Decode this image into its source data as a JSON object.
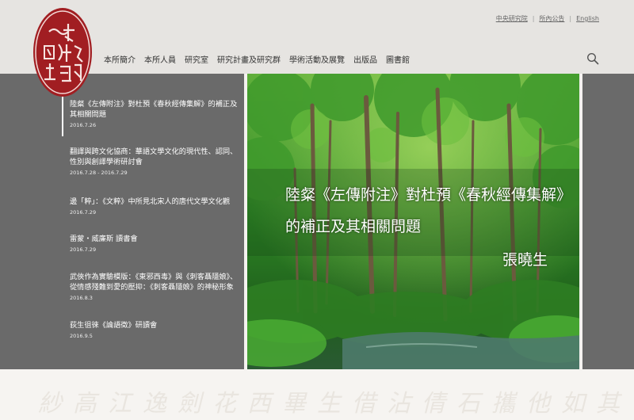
{
  "header": {
    "top_links": [
      "中央研究院",
      "所內公告",
      "English"
    ],
    "seal_text": "中國文哲研究所",
    "nav": [
      "本所簡介",
      "本所人員",
      "研究室",
      "研究計畫及研究群",
      "學術活動及展覽",
      "出版品",
      "圖書館"
    ]
  },
  "news": [
    {
      "title": "陸粲《左傳附注》對杜預《春秋經傳集解》的補正及其相關問題",
      "date": "2016.7.26"
    },
    {
      "title": "翻譯與跨文化協商：華語文學文化的現代性、認同、性別與創譯學術研討會",
      "date": "2016.7.28 - 2016.7.29"
    },
    {
      "title": "邊「粹」：《文粹》中所見北宋人的唐代文學文化觀",
      "date": "2016.7.29"
    },
    {
      "title": "雷蒙・威廉斯 讀書會",
      "date": "2016.7.29"
    },
    {
      "title": "武俠作為實驗模版：《東邪西毒》與《刺客聶隱娘》、從情感殘難到愛的壓抑：《刺客聶隱娘》的神秘形象",
      "date": "2016.8.3"
    },
    {
      "title": "荻生徂徠《論語徵》研讀會",
      "date": "2016.9.5"
    }
  ],
  "hero": {
    "line1": "陸粲《左傳附注》對杜預《春秋經傳集解》",
    "line2": "的補正及其相關問題",
    "author": "張曉生"
  },
  "footer": {
    "calligraphy": "紗高江逸劍花西畢生借沾倩石攜他如其自於酒指"
  }
}
